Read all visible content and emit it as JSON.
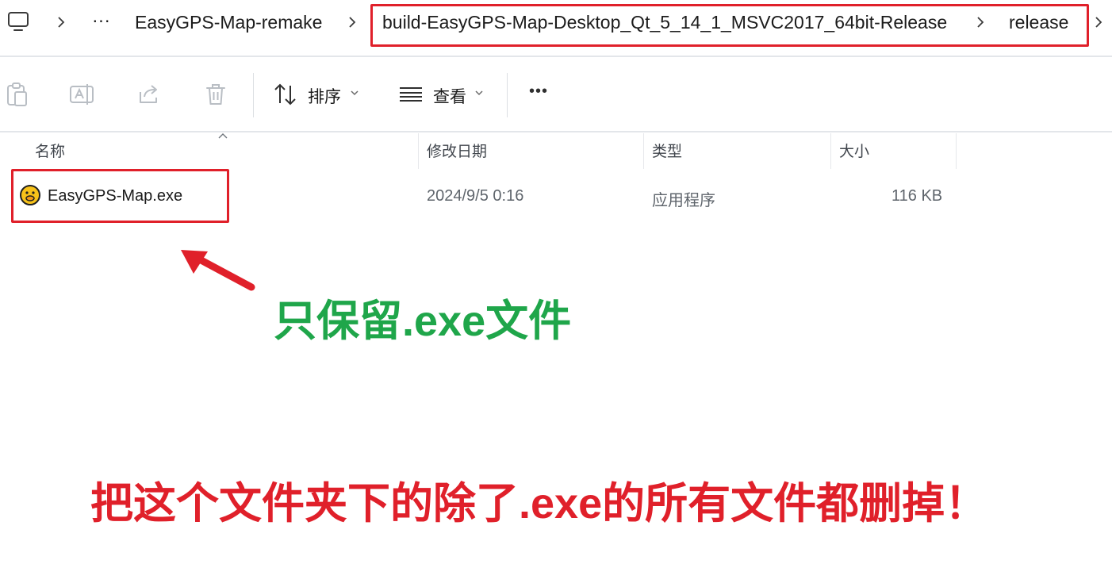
{
  "breadcrumb": {
    "items": [
      "EasyGPS-Map-remake",
      "build-EasyGPS-Map-Desktop_Qt_5_14_1_MSVC2017_64bit-Release",
      "release"
    ],
    "overflow": "···"
  },
  "toolbar": {
    "sort_label": "排序",
    "view_label": "查看",
    "more_label": "•••"
  },
  "file_list": {
    "columns": [
      "名称",
      "修改日期",
      "类型",
      "大小"
    ],
    "rows": [
      {
        "name": "EasyGPS-Map.exe",
        "modified": "2024/9/5 0:16",
        "type": "应用程序",
        "size": "116 KB"
      }
    ]
  },
  "annotations": {
    "keep_note": "只保留.exe文件",
    "delete_note": "把这个文件夹下的除了.exe的所有文件都删掉！",
    "highlight_color": "#e0202a",
    "keep_color": "#1fa64a",
    "delete_color": "#e0202a"
  }
}
